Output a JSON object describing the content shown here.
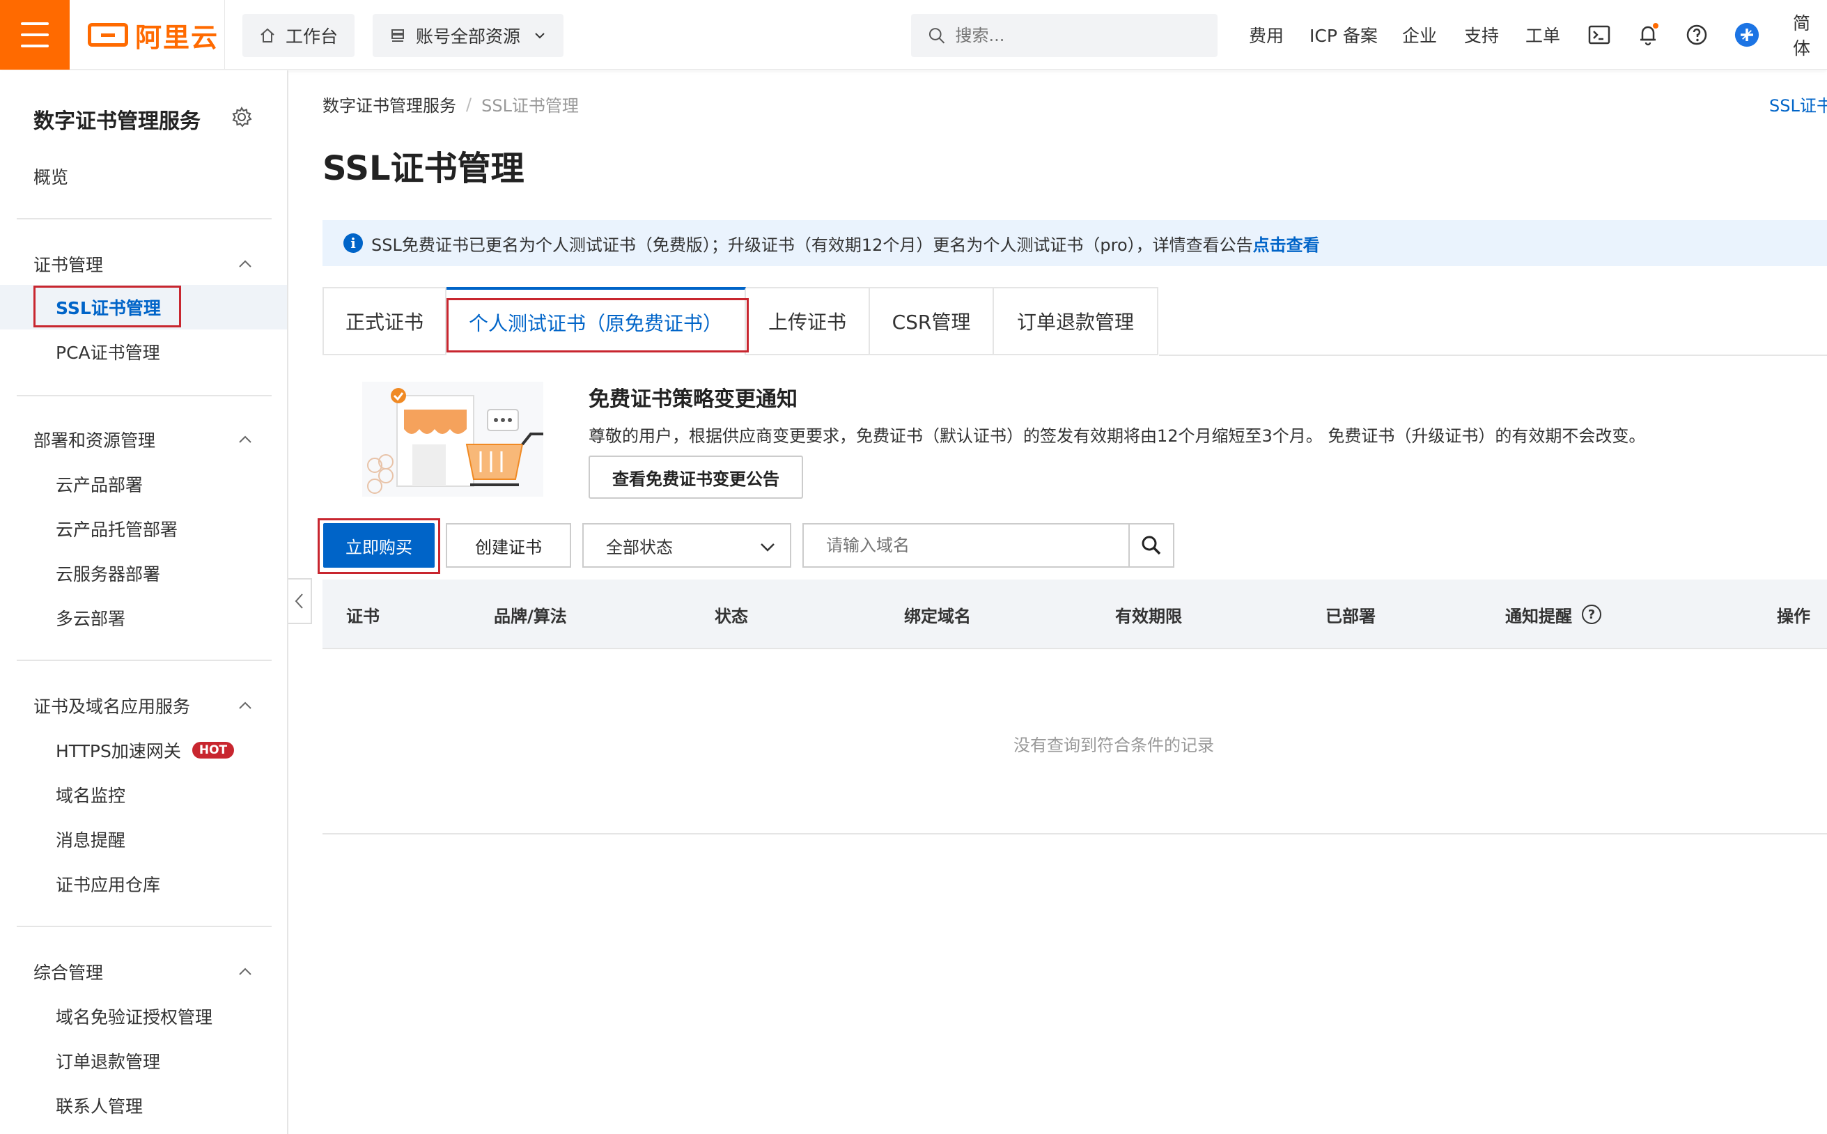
{
  "topbar": {
    "logo_text": "阿里云",
    "workbench_label": "工作台",
    "resources_label": "账号全部资源",
    "search_placeholder": "搜索...",
    "nav": [
      "费用",
      "ICP 备案",
      "企业",
      "支持",
      "工单"
    ],
    "lang_label": "简体"
  },
  "sidebar": {
    "title": "数字证书管理服务",
    "overview": "概览",
    "groups": [
      {
        "label": "证书管理",
        "items": [
          "SSL证书管理",
          "PCA证书管理"
        ]
      },
      {
        "label": "部署和资源管理",
        "items": [
          "云产品部署",
          "云产品托管部署",
          "云服务器部署",
          "多云部署"
        ]
      },
      {
        "label": "证书及域名应用服务",
        "items": [
          "HTTPS加速网关",
          "域名监控",
          "消息提醒",
          "证书应用仓库"
        ]
      },
      {
        "label": "综合管理",
        "items": [
          "域名免验证授权管理",
          "订单退款管理",
          "联系人管理"
        ]
      }
    ],
    "hot_badge": "HOT"
  },
  "main": {
    "breadcrumb": [
      "数字证书管理服务",
      "SSL证书管理"
    ],
    "top_right_link": "SSL证书",
    "title": "SSL证书管理",
    "notice": {
      "text": "SSL免费证书已更名为个人测试证书（免费版）；升级证书（有效期12个月）更名为个人测试证书（pro），详情查看公告",
      "link": "点击查看"
    },
    "tabs": [
      "正式证书",
      "个人测试证书（原免费证书）",
      "上传证书",
      "CSR管理",
      "订单退款管理"
    ],
    "banner": {
      "title": "免费证书策略变更通知",
      "text": "尊敬的用户，根据供应商变更要求，免费证书（默认证书）的签发有效期将由12个月缩短至3个月。 免费证书（升级证书）的有效期不会改变。",
      "button": "查看免费证书变更公告"
    },
    "toolbar": {
      "buy_label": "立即购买",
      "create_label": "创建证书",
      "status_select": "全部状态",
      "domain_placeholder": "请输入域名"
    },
    "table": {
      "columns": [
        "证书",
        "品牌/算法",
        "状态",
        "绑定域名",
        "有效期限",
        "已部署",
        "通知提醒",
        "操作"
      ],
      "empty_text": "没有查询到符合条件的记录"
    }
  },
  "colors": {
    "brand_orange": "#ff6a00",
    "primary_blue": "#0064c8",
    "highlight_red": "#c8262f"
  }
}
